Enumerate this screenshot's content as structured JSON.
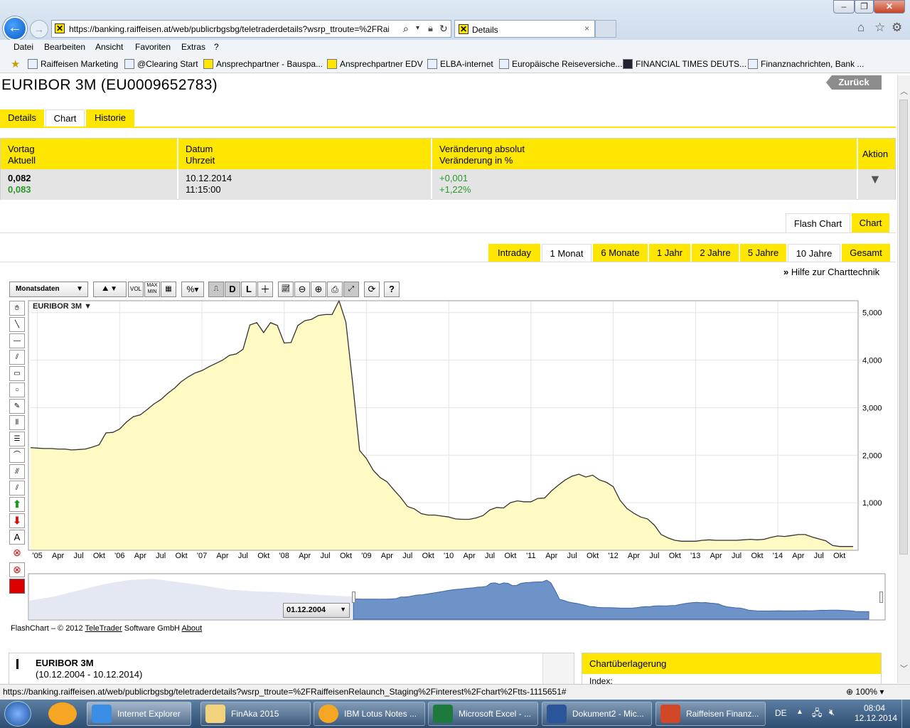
{
  "browser": {
    "url": "https://banking.raiffeisen.at/web/publicrbgsbg/teletraderdetails?wsrp_ttroute=%2FRaiffe",
    "tab_title": "Details",
    "menu": [
      "Datei",
      "Bearbeiten",
      "Ansicht",
      "Favoriten",
      "Extras",
      "?"
    ],
    "favorites": [
      "Raiffeisen Marketing",
      "@Clearing Start",
      "Ansprechpartner - Bauspa...",
      "Ansprechpartner EDV",
      "ELBA-internet",
      "Europäische Reiseversiche...",
      "FINANCIAL TIMES DEUTS...",
      "Finanznachrichten, Bank ..."
    ]
  },
  "page": {
    "title": "EURIBOR 3M (EU0009652783)",
    "back": "Zurück",
    "tabs": [
      "Details",
      "Chart",
      "Historie"
    ],
    "quote": {
      "h1a": "Vortag",
      "h1b": "Aktuell",
      "h2a": "Datum",
      "h2b": "Uhrzeit",
      "h3a": "Veränderung absolut",
      "h3b": "Veränderung in %",
      "h4": "Aktion",
      "vortag": "0,082",
      "aktuell": "0,083",
      "datum": "10.12.2014",
      "uhrzeit": "11:15:00",
      "abs": "+0,001",
      "pct": "+1,22%"
    },
    "chart_tabs": [
      "Flash Chart",
      "Chart"
    ],
    "ranges": [
      "Intraday",
      "1 Monat",
      "6 Monate",
      "1 Jahr",
      "2 Jahre",
      "5 Jahre",
      "10 Jahre",
      "Gesamt"
    ],
    "help": "Hilfe zur Charttechnik",
    "toolbar": {
      "period": "Monatsdaten",
      "vol": "VOL",
      "maxmin": "MAX MIN",
      "pct": "%",
      "d": "D",
      "l": "L",
      "help": "?"
    },
    "chart_label": "EURIBOR 3M",
    "navigator_date": "01.12.2004",
    "footer_a": "FlashChart – © 2012 ",
    "footer_link1": "TeleTrader",
    "footer_b": " Software GmbH ",
    "footer_link2": "About",
    "info_title": "EURIBOR 3M",
    "info_range": "(10.12.2004 - 10.12.2014)",
    "overlay_title": "Chartüberlagerung",
    "overlay_index": "Index:"
  },
  "status": {
    "url": "https://banking.raiffeisen.at/web/publicrbgsbg/teletraderdetails?wsrp_ttroute=%2FRaiffeisenRelaunch_Staging%2Finterest%2Fchart%2Ftts-1115651#",
    "zoom": "100%"
  },
  "taskbar": {
    "items": [
      "Internet Explorer",
      "FinAka 2015",
      "IBM Lotus Notes ...",
      "Microsoft Excel - ...",
      "Dokument2 - Mic...",
      "Raiffeisen Finanz..."
    ],
    "lang": "DE",
    "time": "08:04",
    "date": "12.12.2014"
  },
  "chart_data": {
    "type": "area",
    "title": "EURIBOR 3M",
    "x_labels": [
      "'05",
      "Apr",
      "Jul",
      "Okt",
      "'06",
      "Apr",
      "Jul",
      "Okt",
      "'07",
      "Apr",
      "Jul",
      "Okt",
      "'08",
      "Apr",
      "Jul",
      "Okt",
      "'09",
      "Apr",
      "Jul",
      "Okt",
      "'10",
      "Apr",
      "Jul",
      "Okt",
      "'11",
      "Apr",
      "Jul",
      "Okt",
      "'12",
      "Apr",
      "Jul",
      "Okt",
      "'13",
      "Apr",
      "Jul",
      "Okt",
      "'14",
      "Apr",
      "Jul",
      "Okt"
    ],
    "y_ticks": [
      "1,000",
      "2,000",
      "3,000",
      "4,000",
      "5,000"
    ],
    "ylim": [
      0,
      5.25
    ],
    "x": [
      "2004-12",
      "2005-01",
      "2005-02",
      "2005-03",
      "2005-04",
      "2005-05",
      "2005-06",
      "2005-07",
      "2005-08",
      "2005-09",
      "2005-10",
      "2005-11",
      "2005-12",
      "2006-01",
      "2006-02",
      "2006-03",
      "2006-04",
      "2006-05",
      "2006-06",
      "2006-07",
      "2006-08",
      "2006-09",
      "2006-10",
      "2006-11",
      "2006-12",
      "2007-01",
      "2007-02",
      "2007-03",
      "2007-04",
      "2007-05",
      "2007-06",
      "2007-07",
      "2007-08",
      "2007-09",
      "2007-10",
      "2007-11",
      "2007-12",
      "2008-01",
      "2008-02",
      "2008-03",
      "2008-04",
      "2008-05",
      "2008-06",
      "2008-07",
      "2008-08",
      "2008-09",
      "2008-10",
      "2008-11",
      "2008-12",
      "2009-01",
      "2009-02",
      "2009-03",
      "2009-04",
      "2009-05",
      "2009-06",
      "2009-07",
      "2009-08",
      "2009-09",
      "2009-10",
      "2009-11",
      "2009-12",
      "2010-01",
      "2010-02",
      "2010-03",
      "2010-04",
      "2010-05",
      "2010-06",
      "2010-07",
      "2010-08",
      "2010-09",
      "2010-10",
      "2010-11",
      "2010-12",
      "2011-01",
      "2011-02",
      "2011-03",
      "2011-04",
      "2011-05",
      "2011-06",
      "2011-07",
      "2011-08",
      "2011-09",
      "2011-10",
      "2011-11",
      "2011-12",
      "2012-01",
      "2012-02",
      "2012-03",
      "2012-04",
      "2012-05",
      "2012-06",
      "2012-07",
      "2012-08",
      "2012-09",
      "2012-10",
      "2012-11",
      "2012-12",
      "2013-01",
      "2013-02",
      "2013-03",
      "2013-04",
      "2013-05",
      "2013-06",
      "2013-07",
      "2013-08",
      "2013-09",
      "2013-10",
      "2013-11",
      "2013-12",
      "2014-01",
      "2014-02",
      "2014-03",
      "2014-04",
      "2014-05",
      "2014-06",
      "2014-07",
      "2014-08",
      "2014-09",
      "2014-10",
      "2014-11",
      "2014-12"
    ],
    "values": [
      2.16,
      2.15,
      2.14,
      2.14,
      2.13,
      2.13,
      2.11,
      2.12,
      2.13,
      2.17,
      2.22,
      2.47,
      2.48,
      2.55,
      2.7,
      2.81,
      2.85,
      2.96,
      3.08,
      3.17,
      3.3,
      3.41,
      3.55,
      3.65,
      3.73,
      3.78,
      3.86,
      3.93,
      4.0,
      4.1,
      4.13,
      4.23,
      4.74,
      4.79,
      4.58,
      4.79,
      4.73,
      4.36,
      4.37,
      4.73,
      4.83,
      4.86,
      4.94,
      4.96,
      4.96,
      5.25,
      4.8,
      3.5,
      2.1,
      1.93,
      1.68,
      1.53,
      1.44,
      1.27,
      1.11,
      0.92,
      0.87,
      0.77,
      0.74,
      0.74,
      0.72,
      0.7,
      0.66,
      0.65,
      0.65,
      0.68,
      0.73,
      0.85,
      0.9,
      0.89,
      1.0,
      1.04,
      1.02,
      1.02,
      1.09,
      1.1,
      1.25,
      1.37,
      1.48,
      1.56,
      1.6,
      1.54,
      1.58,
      1.48,
      1.43,
      1.34,
      1.05,
      0.88,
      0.78,
      0.7,
      0.66,
      0.53,
      0.33,
      0.26,
      0.21,
      0.19,
      0.19,
      0.19,
      0.21,
      0.22,
      0.21,
      0.21,
      0.21,
      0.21,
      0.22,
      0.23,
      0.22,
      0.23,
      0.27,
      0.3,
      0.29,
      0.31,
      0.33,
      0.33,
      0.28,
      0.24,
      0.2,
      0.1,
      0.08,
      0.08,
      0.08
    ]
  }
}
